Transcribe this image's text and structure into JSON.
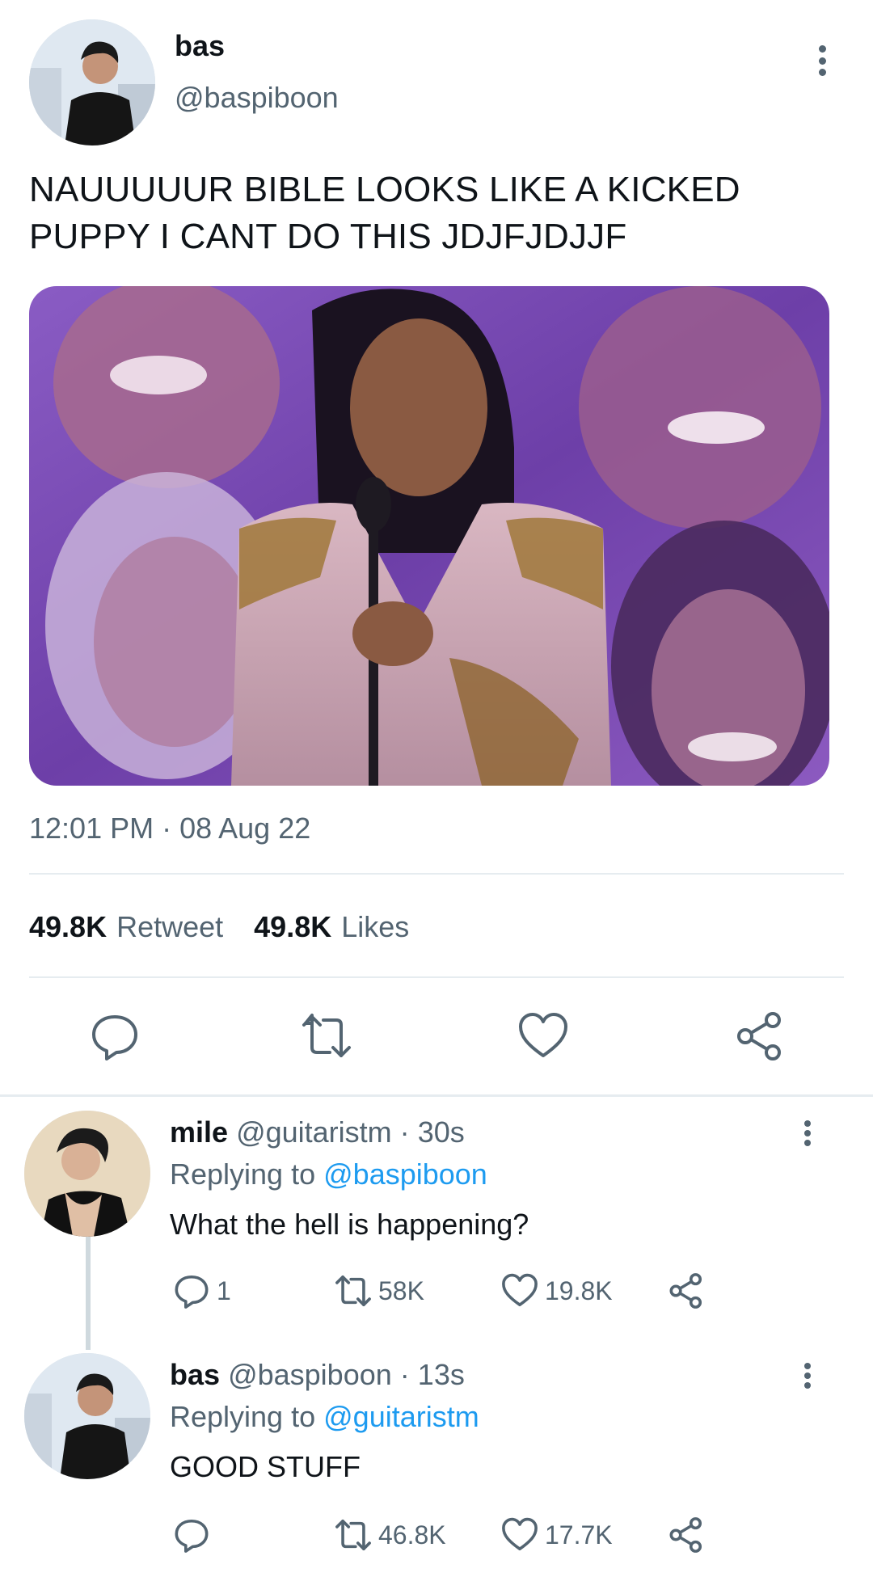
{
  "main_tweet": {
    "display_name": "bas",
    "handle": "@baspiboon",
    "text_line1": "NAUUUUUR BIBLE LOOKS LIKE A KICKED",
    "text_line2": "PUPPY I CANT DO THIS JDJFJDJJF",
    "timestamp": "12:01 PM · 08 Aug 22",
    "retweet_count": "49.8K",
    "retweet_label": "Retweet",
    "likes_count": "49.8K",
    "likes_label": "Likes",
    "actions": [
      "reply-icon",
      "retweet-icon",
      "like-icon",
      "share-icon"
    ]
  },
  "replies": [
    {
      "display_name": "mile",
      "handle": "@guitaristm",
      "time": "30s",
      "replying_prefix": "Replying to",
      "replying_to": "@baspiboon",
      "text": "What the hell is happening?",
      "reply_count": "1",
      "retweet_count": "58K",
      "like_count": "19.8K"
    },
    {
      "display_name": "bas",
      "handle": "@baspiboon",
      "time": "13s",
      "replying_prefix": "Replying to",
      "replying_to": "@guitaristm",
      "text": "GOOD STUFF",
      "reply_count": "",
      "retweet_count": "46.8K",
      "like_count": "17.7K"
    }
  ],
  "colors": {
    "text_primary": "#0f1419",
    "text_secondary": "#536471",
    "link": "#1d9bf0",
    "divider": "#e6ecf0",
    "media_purple": "#7a4fb0"
  }
}
